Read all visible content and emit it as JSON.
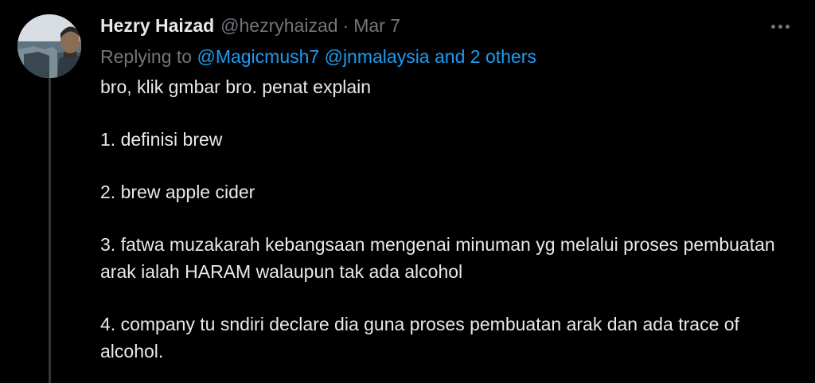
{
  "author": {
    "display_name": "Hezry Haizad",
    "handle": "@hezryhaizad",
    "separator": "·",
    "date": "Mar 7"
  },
  "reply": {
    "prefix": "Replying to ",
    "mentions": [
      "@Magicmush7",
      "@jnmalaysia"
    ],
    "others": "and 2 others"
  },
  "body": {
    "lines": [
      "bro, klik gmbar bro. penat explain",
      "1. definisi brew",
      "2. brew apple cider",
      "3. fatwa muzakarah kebangsaan mengenai minuman yg melalui proses pembuatan arak ialah HARAM walaupun tak ada alcohol",
      "4. company tu sndiri declare dia guna proses pembuatan arak dan ada trace of alcohol."
    ]
  },
  "colors": {
    "background": "#000000",
    "text": "#e7e9ea",
    "muted": "#71767b",
    "link": "#1d9bf0",
    "thread_line": "#333639"
  },
  "icons": {
    "more": "more-horizontal-icon"
  }
}
